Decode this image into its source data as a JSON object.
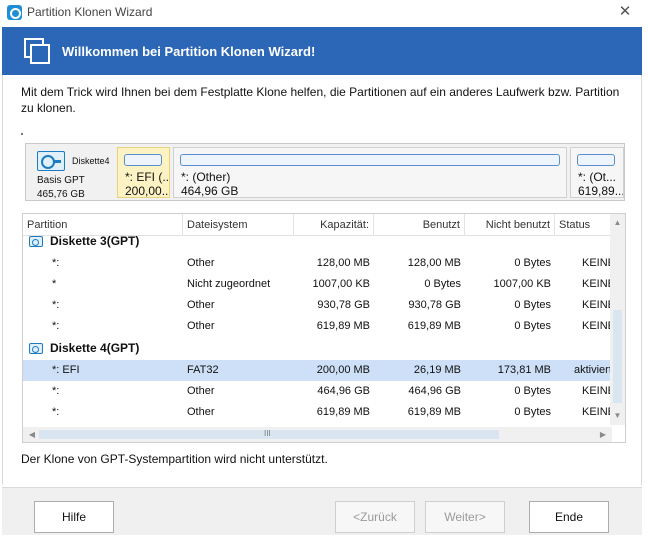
{
  "window": {
    "title": "Partition Klonen Wizard",
    "close_glyph": "✕"
  },
  "banner": {
    "title": "Willkommen bei Partition Klonen Wizard!"
  },
  "intro_text": "Mit dem Trick wird Ihnen bei dem Festplatte Klone helfen, die Partitionen auf ein anderes Laufwerk bzw. Partition zu klonen.",
  "disk_map": {
    "disk_name": "Diskette4",
    "disk_type": "Basis GPT",
    "disk_size": "465,76 GB",
    "partitions": [
      {
        "label": "*: EFI (...",
        "size": "200,00..."
      },
      {
        "label": "*: (Other)",
        "size": "464,96 GB"
      },
      {
        "label": "*: (Ot...",
        "size": "619,89..."
      }
    ]
  },
  "table": {
    "columns": [
      "Partition",
      "Dateisystem",
      "Kapazität:",
      "Benutzt",
      "Nicht benutzt",
      "Status"
    ],
    "groups": [
      {
        "name": "Diskette 3(GPT)",
        "rows": [
          [
            "*:",
            "Other",
            "128,00 MB",
            "128,00 MB",
            "0 Bytes",
            "KEINE"
          ],
          [
            "*",
            "Nicht zugeordnet",
            "1007,00 KB",
            "0 Bytes",
            "1007,00 KB",
            "KEINE"
          ],
          [
            "*:",
            "Other",
            "930,78 GB",
            "930,78 GB",
            "0 Bytes",
            "KEINE"
          ],
          [
            "*:",
            "Other",
            "619,89 MB",
            "619,89 MB",
            "0 Bytes",
            "KEINE"
          ]
        ]
      },
      {
        "name": "Diskette 4(GPT)",
        "rows": [
          [
            "*: EFI",
            "FAT32",
            "200,00 MB",
            "26,19 MB",
            "173,81 MB",
            "aktiviert"
          ],
          [
            "*:",
            "Other",
            "464,96 GB",
            "464,96 GB",
            "0 Bytes",
            "KEINE"
          ],
          [
            "*:",
            "Other",
            "619,89 MB",
            "619,89 MB",
            "0 Bytes",
            "KEINE"
          ]
        ]
      }
    ],
    "hscroll_grip": "III"
  },
  "note": "Der Klone von GPT-Systempartition wird nicht unterstützt.",
  "buttons": {
    "help": "Hilfe",
    "back": "<Zurück",
    "next": "Weiter>",
    "finish": "Ende"
  }
}
